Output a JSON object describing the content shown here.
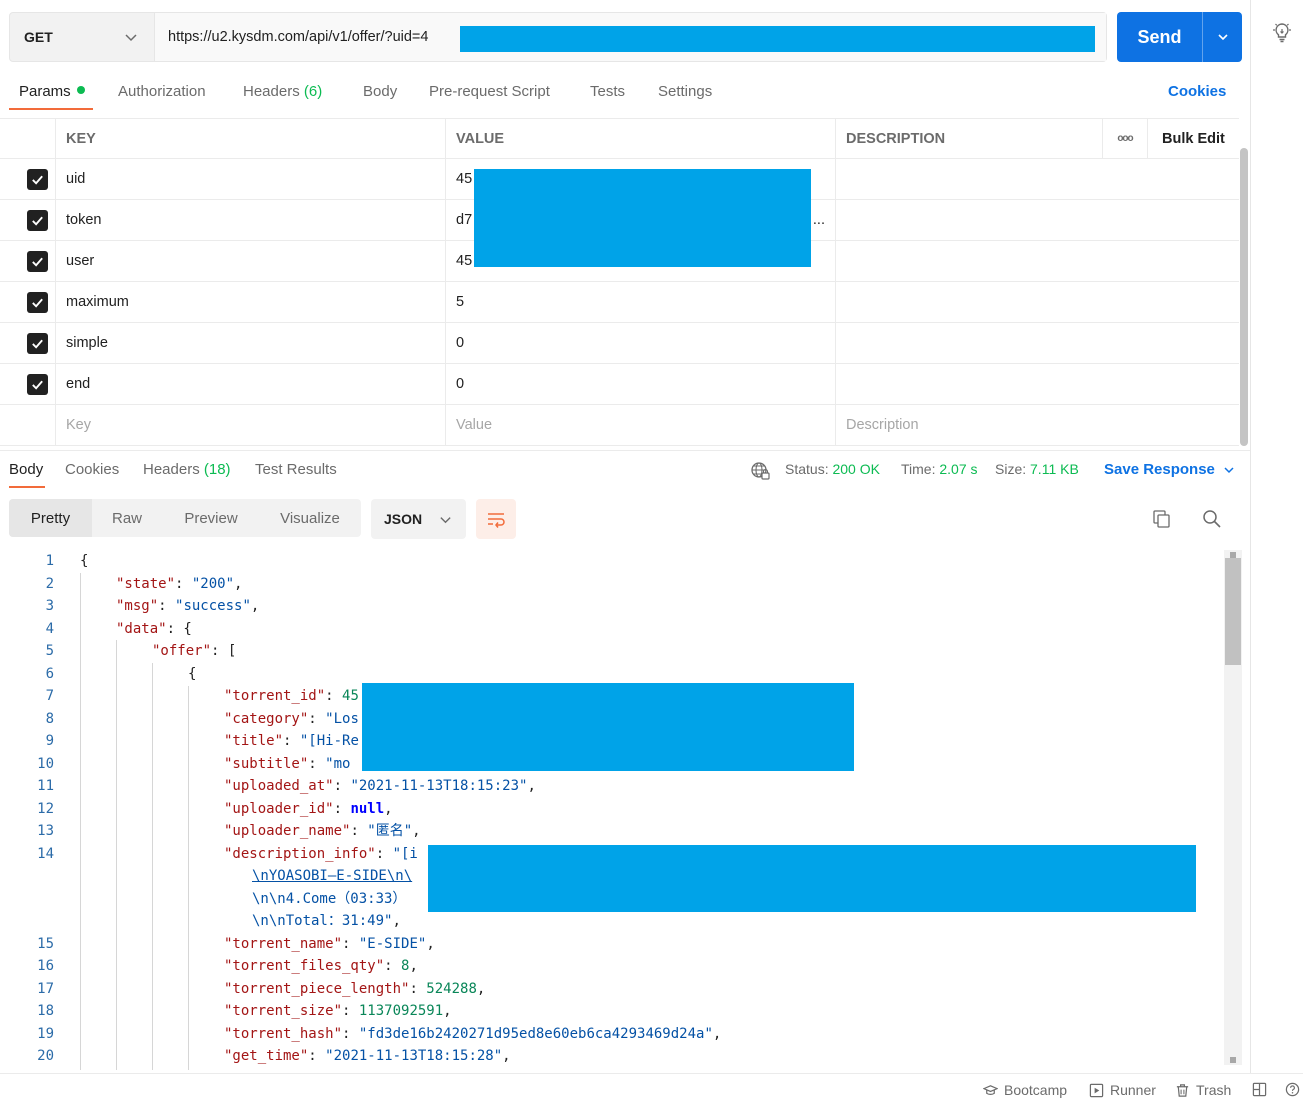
{
  "request": {
    "method": "GET",
    "url": "https://u2.kysdm.com/api/v1/offer/?uid=4",
    "send_label": "Send"
  },
  "request_tabs": {
    "params": "Params",
    "authorization": "Authorization",
    "headers": "Headers",
    "headers_count": "(6)",
    "body": "Body",
    "prerequest": "Pre-request Script",
    "tests": "Tests",
    "settings": "Settings",
    "cookies": "Cookies"
  },
  "params_table": {
    "headers": {
      "key": "KEY",
      "value": "VALUE",
      "description": "DESCRIPTION",
      "more": "ooo",
      "bulk_edit": "Bulk Edit"
    },
    "rows": [
      {
        "key": "uid",
        "value": "45",
        "checked": true
      },
      {
        "key": "token",
        "value": "d7",
        "value_suffix": "...",
        "checked": true
      },
      {
        "key": "user",
        "value": "45",
        "checked": true
      },
      {
        "key": "maximum",
        "value": "5",
        "checked": true
      },
      {
        "key": "simple",
        "value": "0",
        "checked": true
      },
      {
        "key": "end",
        "value": "0",
        "checked": true
      }
    ],
    "placeholders": {
      "key": "Key",
      "value": "Value",
      "description": "Description"
    }
  },
  "response_tabs": {
    "body": "Body",
    "cookies": "Cookies",
    "headers": "Headers",
    "headers_count": "(18)",
    "test_results": "Test Results",
    "status_label": "Status:",
    "status_value": "200 OK",
    "time_label": "Time:",
    "time_value": "2.07 s",
    "size_label": "Size:",
    "size_value": "7.11 KB",
    "save_response": "Save Response"
  },
  "view_toolbar": {
    "modes": [
      "Pretty",
      "Raw",
      "Preview",
      "Visualize"
    ],
    "active_mode": "Pretty",
    "format": "JSON"
  },
  "code_lines": [
    {
      "n": "1",
      "parts": [
        [
          "p",
          "{"
        ]
      ]
    },
    {
      "n": "2",
      "parts": [
        [
          "k",
          "\"state\""
        ],
        [
          "p",
          ": "
        ],
        [
          "s",
          "\"200\""
        ],
        [
          "p",
          ","
        ]
      ]
    },
    {
      "n": "3",
      "parts": [
        [
          "k",
          "\"msg\""
        ],
        [
          "p",
          ": "
        ],
        [
          "s",
          "\"success\""
        ],
        [
          "p",
          ","
        ]
      ]
    },
    {
      "n": "4",
      "parts": [
        [
          "k",
          "\"data\""
        ],
        [
          "p",
          ": {"
        ]
      ]
    },
    {
      "n": "5",
      "parts": [
        [
          "k",
          "\"offer\""
        ],
        [
          "p",
          ": ["
        ]
      ]
    },
    {
      "n": "6",
      "parts": [
        [
          "p",
          "{"
        ]
      ]
    },
    {
      "n": "7",
      "parts": [
        [
          "k",
          "\"torrent_id\""
        ],
        [
          "p",
          ": "
        ],
        [
          "n",
          "45"
        ]
      ]
    },
    {
      "n": "8",
      "parts": [
        [
          "k",
          "\"category\""
        ],
        [
          "p",
          ": "
        ],
        [
          "s",
          "\"Los"
        ]
      ]
    },
    {
      "n": "9",
      "parts": [
        [
          "k",
          "\"title\""
        ],
        [
          "p",
          ": "
        ],
        [
          "s",
          "\"[Hi-Re"
        ]
      ]
    },
    {
      "n": "10",
      "parts": [
        [
          "k",
          "\"subtitle\""
        ],
        [
          "p",
          ": "
        ],
        [
          "s",
          "\"mo"
        ]
      ]
    },
    {
      "n": "11",
      "parts": [
        [
          "k",
          "\"uploaded_at\""
        ],
        [
          "p",
          ": "
        ],
        [
          "s",
          "\"2021-11-13T18:15:23\""
        ],
        [
          "p",
          ","
        ]
      ]
    },
    {
      "n": "12",
      "parts": [
        [
          "k",
          "\"uploader_id\""
        ],
        [
          "p",
          ": "
        ],
        [
          "kw",
          "null"
        ],
        [
          "p",
          ","
        ]
      ]
    },
    {
      "n": "13",
      "parts": [
        [
          "k",
          "\"uploader_name\""
        ],
        [
          "p",
          ": "
        ],
        [
          "s",
          "\"匿名\""
        ],
        [
          "p",
          ","
        ]
      ]
    },
    {
      "n": "14",
      "parts": [
        [
          "k",
          "\"description_info\""
        ],
        [
          "p",
          ": "
        ],
        [
          "s",
          "\"[i"
        ]
      ]
    },
    {
      "n": "",
      "parts": [
        [
          "su",
          "\\nYOASOBI—E-SIDE\\n\\"
        ]
      ]
    },
    {
      "n": "",
      "parts": [
        [
          "s",
          "\\n\\n4.Come（03:33）"
        ]
      ]
    },
    {
      "n": "",
      "parts": [
        [
          "s",
          "\\n\\nTotal：31:49\""
        ],
        [
          "p",
          ","
        ]
      ]
    },
    {
      "n": "15",
      "parts": [
        [
          "k",
          "\"torrent_name\""
        ],
        [
          "p",
          ": "
        ],
        [
          "s",
          "\"E-SIDE\""
        ],
        [
          "p",
          ","
        ]
      ]
    },
    {
      "n": "16",
      "parts": [
        [
          "k",
          "\"torrent_files_qty\""
        ],
        [
          "p",
          ": "
        ],
        [
          "n",
          "8"
        ],
        [
          "p",
          ","
        ]
      ]
    },
    {
      "n": "17",
      "parts": [
        [
          "k",
          "\"torrent_piece_length\""
        ],
        [
          "p",
          ": "
        ],
        [
          "n",
          "524288"
        ],
        [
          "p",
          ","
        ]
      ]
    },
    {
      "n": "18",
      "parts": [
        [
          "k",
          "\"torrent_size\""
        ],
        [
          "p",
          ": "
        ],
        [
          "n",
          "1137092591"
        ],
        [
          "p",
          ","
        ]
      ]
    },
    {
      "n": "19",
      "parts": [
        [
          "k",
          "\"torrent_hash\""
        ],
        [
          "p",
          ": "
        ],
        [
          "s",
          "\"fd3de16b2420271d95ed8e60eb6ca4293469d24a\""
        ],
        [
          "p",
          ","
        ]
      ]
    },
    {
      "n": "20",
      "parts": [
        [
          "k",
          "\"get_time\""
        ],
        [
          "p",
          ": "
        ],
        [
          "s",
          "\"2021-11-13T18:15:28\""
        ],
        [
          "p",
          ","
        ]
      ]
    }
  ],
  "status_bar": {
    "bootcamp": "Bootcamp",
    "runner": "Runner",
    "trash": "Trash"
  },
  "colors": {
    "accent_blue": "#0e72e3",
    "tab_underline": "#f26b3a",
    "success_green": "#0cbb52",
    "redaction": "#00a3e8"
  }
}
